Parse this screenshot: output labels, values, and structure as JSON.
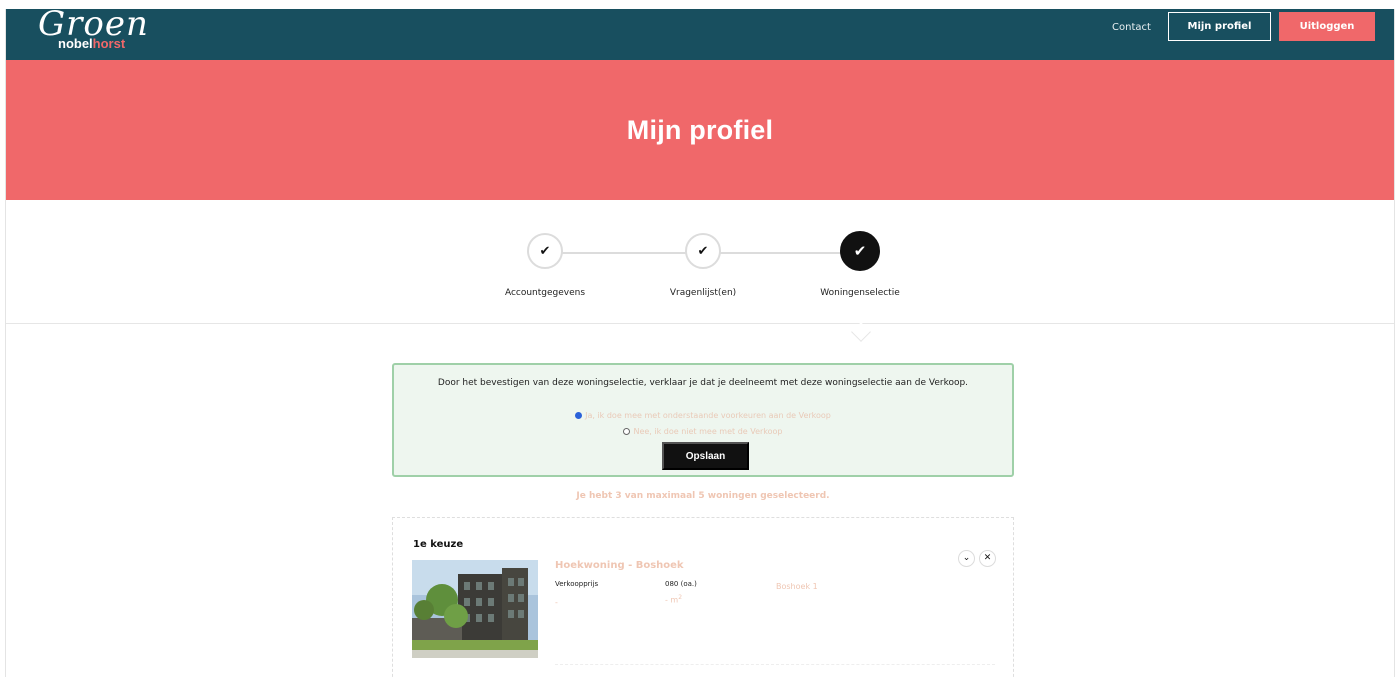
{
  "header": {
    "logo_script": "Groen",
    "logo_sub_white": "nobel",
    "logo_sub_accent": "horst",
    "nav_contact": "Contact",
    "btn_profile": "Mijn profiel",
    "btn_logout": "Uitloggen"
  },
  "hero": {
    "title": "Mijn profiel"
  },
  "stepper": {
    "steps": [
      {
        "label": "Accountgegevens",
        "status": "done"
      },
      {
        "label": "Vragenlijst(en)",
        "status": "done"
      },
      {
        "label": "Woningenselectie",
        "status": "active"
      }
    ]
  },
  "confirm": {
    "text": "Door het bevestigen van deze woningselectie, verklaar je dat je deelneemt met deze woningselectie aan de Verkoop.",
    "option_yes": "Ja, ik doe mee met onderstaande voorkeuren aan de Verkoop",
    "option_no": "Nee, ik doe niet mee met de Verkoop",
    "selected": "yes",
    "save_label": "Opslaan"
  },
  "selection_counter": "Je hebt 3 van maximaal 5 woningen geselecteerd.",
  "choice": {
    "title": "1e keuze",
    "home_title": "Hoekwoning - Boshoek",
    "label_price": "Verkoopprijs",
    "price_value": "-",
    "price_suffix": "080 (oa.)",
    "area_value": "- m",
    "area_unit": "2",
    "address": "Boshoek 1"
  },
  "colors": {
    "header_bg": "#184f5f",
    "accent": "#f0686a",
    "confirm_bg": "#eef6ef",
    "confirm_border": "#9fd0a8",
    "muted_peach": "#efc6b3"
  }
}
